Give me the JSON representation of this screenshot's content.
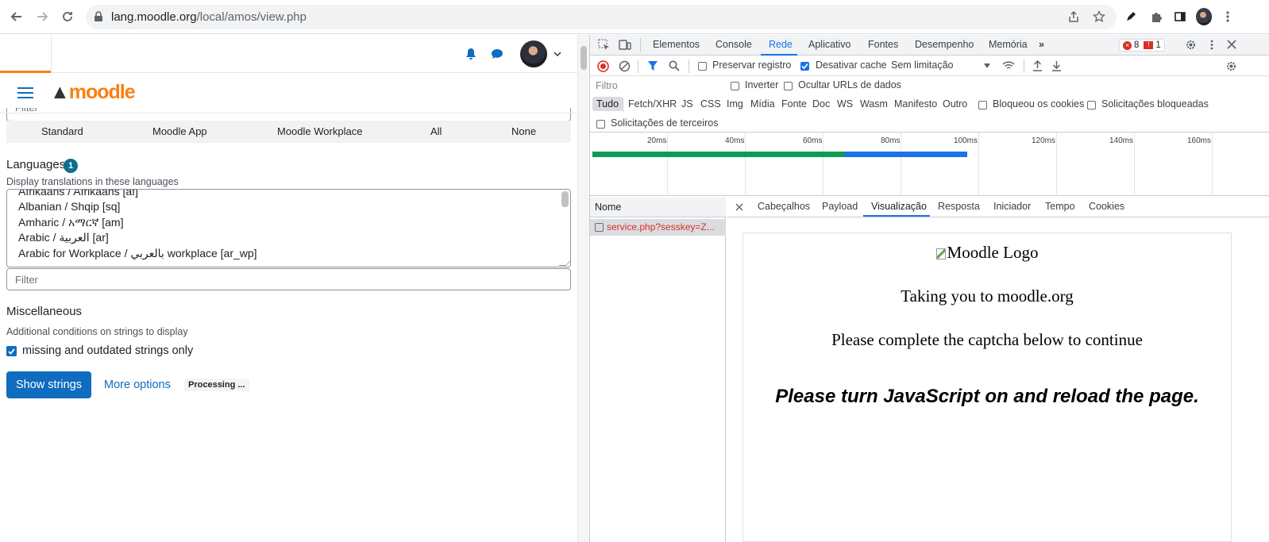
{
  "browser": {
    "url_host": "lang.moodle.org",
    "url_path": "/local/amos/view.php"
  },
  "moodle": {
    "logo_text": "moodle",
    "component_tabs": [
      "Standard",
      "Moodle App",
      "Moodle Workplace",
      "All",
      "None"
    ],
    "languages_title": "Languages",
    "languages_badge": "1",
    "languages_sub": "Display translations in these languages",
    "languages": [
      "Afrikaans / Afrikaans [af]",
      "Albanian / Shqip [sq]",
      "Amharic / አማርኛ [am]",
      "Arabic / العربية [ar]",
      "Arabic for Workplace / بالعربي workplace [ar_wp]"
    ],
    "filter_placeholder": "Filter",
    "misc_title": "Miscellaneous",
    "misc_sub": "Additional conditions on strings to display",
    "misc_checkbox": "missing and outdated strings only",
    "show_strings": "Show strings",
    "more_options": "More options",
    "processing": "Processing ..."
  },
  "devtools": {
    "tabs": [
      "Elementos",
      "Console",
      "Rede",
      "Aplicativo",
      "Fontes",
      "Desempenho",
      "Memória"
    ],
    "errors": "8",
    "warnings": "1",
    "preserve_log": "Preservar registro",
    "disable_cache": "Desativar cache",
    "throttle": "Sem limitação",
    "filter_placeholder": "Filtro",
    "invert": "Inverter",
    "hide_data_urls": "Ocultar URLs de dados",
    "type_filters": [
      "Tudo",
      "Fetch/XHR",
      "JS",
      "CSS",
      "Img",
      "Mídia",
      "Fonte",
      "Doc",
      "WS",
      "Wasm",
      "Manifesto",
      "Outro"
    ],
    "blocked_cookies": "Bloqueou os cookies",
    "blocked_requests": "Solicitações bloqueadas",
    "third_party": "Solicitações de terceiros",
    "timeline_ticks": [
      "20ms",
      "40ms",
      "60ms",
      "80ms",
      "100ms",
      "120ms",
      "140ms",
      "160ms"
    ],
    "name_header": "Nome",
    "request_name": "service.php?sesskey=Z...",
    "detail_tabs": [
      "Cabeçalhos",
      "Payload",
      "Visualização",
      "Resposta",
      "Iniciador",
      "Tempo",
      "Cookies"
    ],
    "preview": {
      "logo_alt": "Moodle Logo",
      "line1": "Taking you to moodle.org",
      "line2": "Please complete the captcha below to continue",
      "line3": "Please turn JavaScript on and reload the page."
    }
  }
}
